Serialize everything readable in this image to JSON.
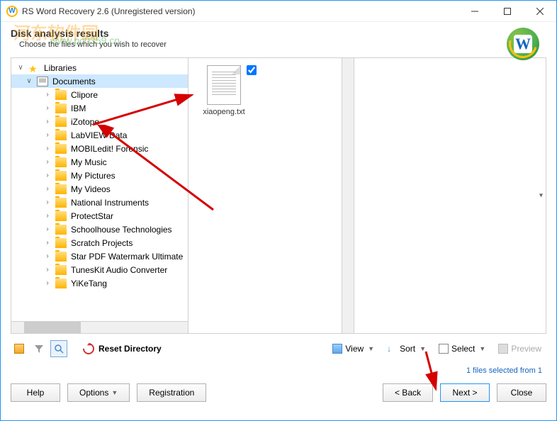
{
  "window": {
    "title": "RS Word Recovery 2.6 (Unregistered version)",
    "appIconLetter": "W"
  },
  "header": {
    "title": "Disk analysis results",
    "subtitle": "Choose the files which you wish to recover",
    "logoLetter": "W"
  },
  "watermark": {
    "text": "河东软件园",
    "url": "www.pc0359.cn"
  },
  "tree": {
    "root": {
      "label": "Libraries"
    },
    "selected": {
      "label": "Documents"
    },
    "folders": [
      "Clipore",
      "IBM",
      "iZotope",
      "LabVIEW Data",
      "MOBILedit! Forensic",
      "My Music",
      "My Pictures",
      "My Videos",
      "National Instruments",
      "ProtectStar",
      "Schoolhouse Technologies",
      "Scratch Projects",
      "Star PDF Watermark Ultimate",
      "TunesKit Audio Converter",
      "YiKeTang"
    ]
  },
  "files": [
    {
      "name": "xiaopeng.txt",
      "checked": true
    }
  ],
  "toolbar": {
    "reset": "Reset Directory",
    "view": "View",
    "sort": "Sort",
    "select": "Select",
    "preview": "Preview"
  },
  "status": {
    "text": "1 files selected from 1"
  },
  "buttons": {
    "help": "Help",
    "options": "Options",
    "registration": "Registration",
    "back": "< Back",
    "next": "Next >",
    "close": "Close"
  }
}
